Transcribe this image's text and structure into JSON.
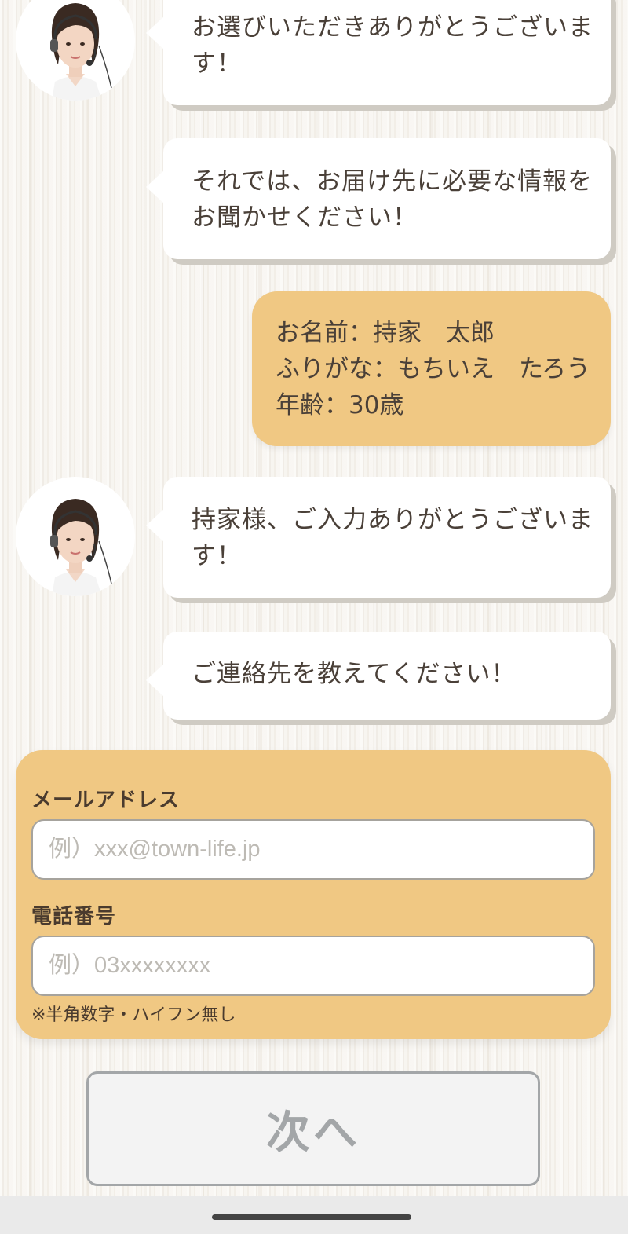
{
  "chat": {
    "messages": [
      {
        "lines": [
          "お選びいただきありがとうございま",
          "す！"
        ]
      },
      {
        "lines": [
          "それでは、お届け先に必要な情報を",
          "お聞かせください！"
        ]
      },
      {
        "lines": [
          "持家様、ご入力ありがとうございま",
          "す！"
        ]
      },
      {
        "lines": [
          "ご連絡先を教えてください！"
        ]
      }
    ],
    "user_reply": {
      "lines": [
        "お名前：持家　太郎",
        "ふりがな：もちいえ　たろう",
        "年齢：30歳"
      ]
    }
  },
  "form": {
    "email_label": "メールアドレス",
    "email_placeholder": "例）xxx@town-life.jp",
    "email_value": "",
    "phone_label": "電話番号",
    "phone_placeholder": "例）03xxxxxxxx",
    "phone_value": "",
    "phone_note": "※半角数字・ハイフン無し"
  },
  "next_button_label": "次へ",
  "colors": {
    "accent": "#f0c883",
    "text": "#4a4038",
    "button_disabled": "#a3a6a8"
  },
  "icons": {
    "operator_avatar": "operator-headset-avatar",
    "home_indicator": "home-indicator"
  }
}
